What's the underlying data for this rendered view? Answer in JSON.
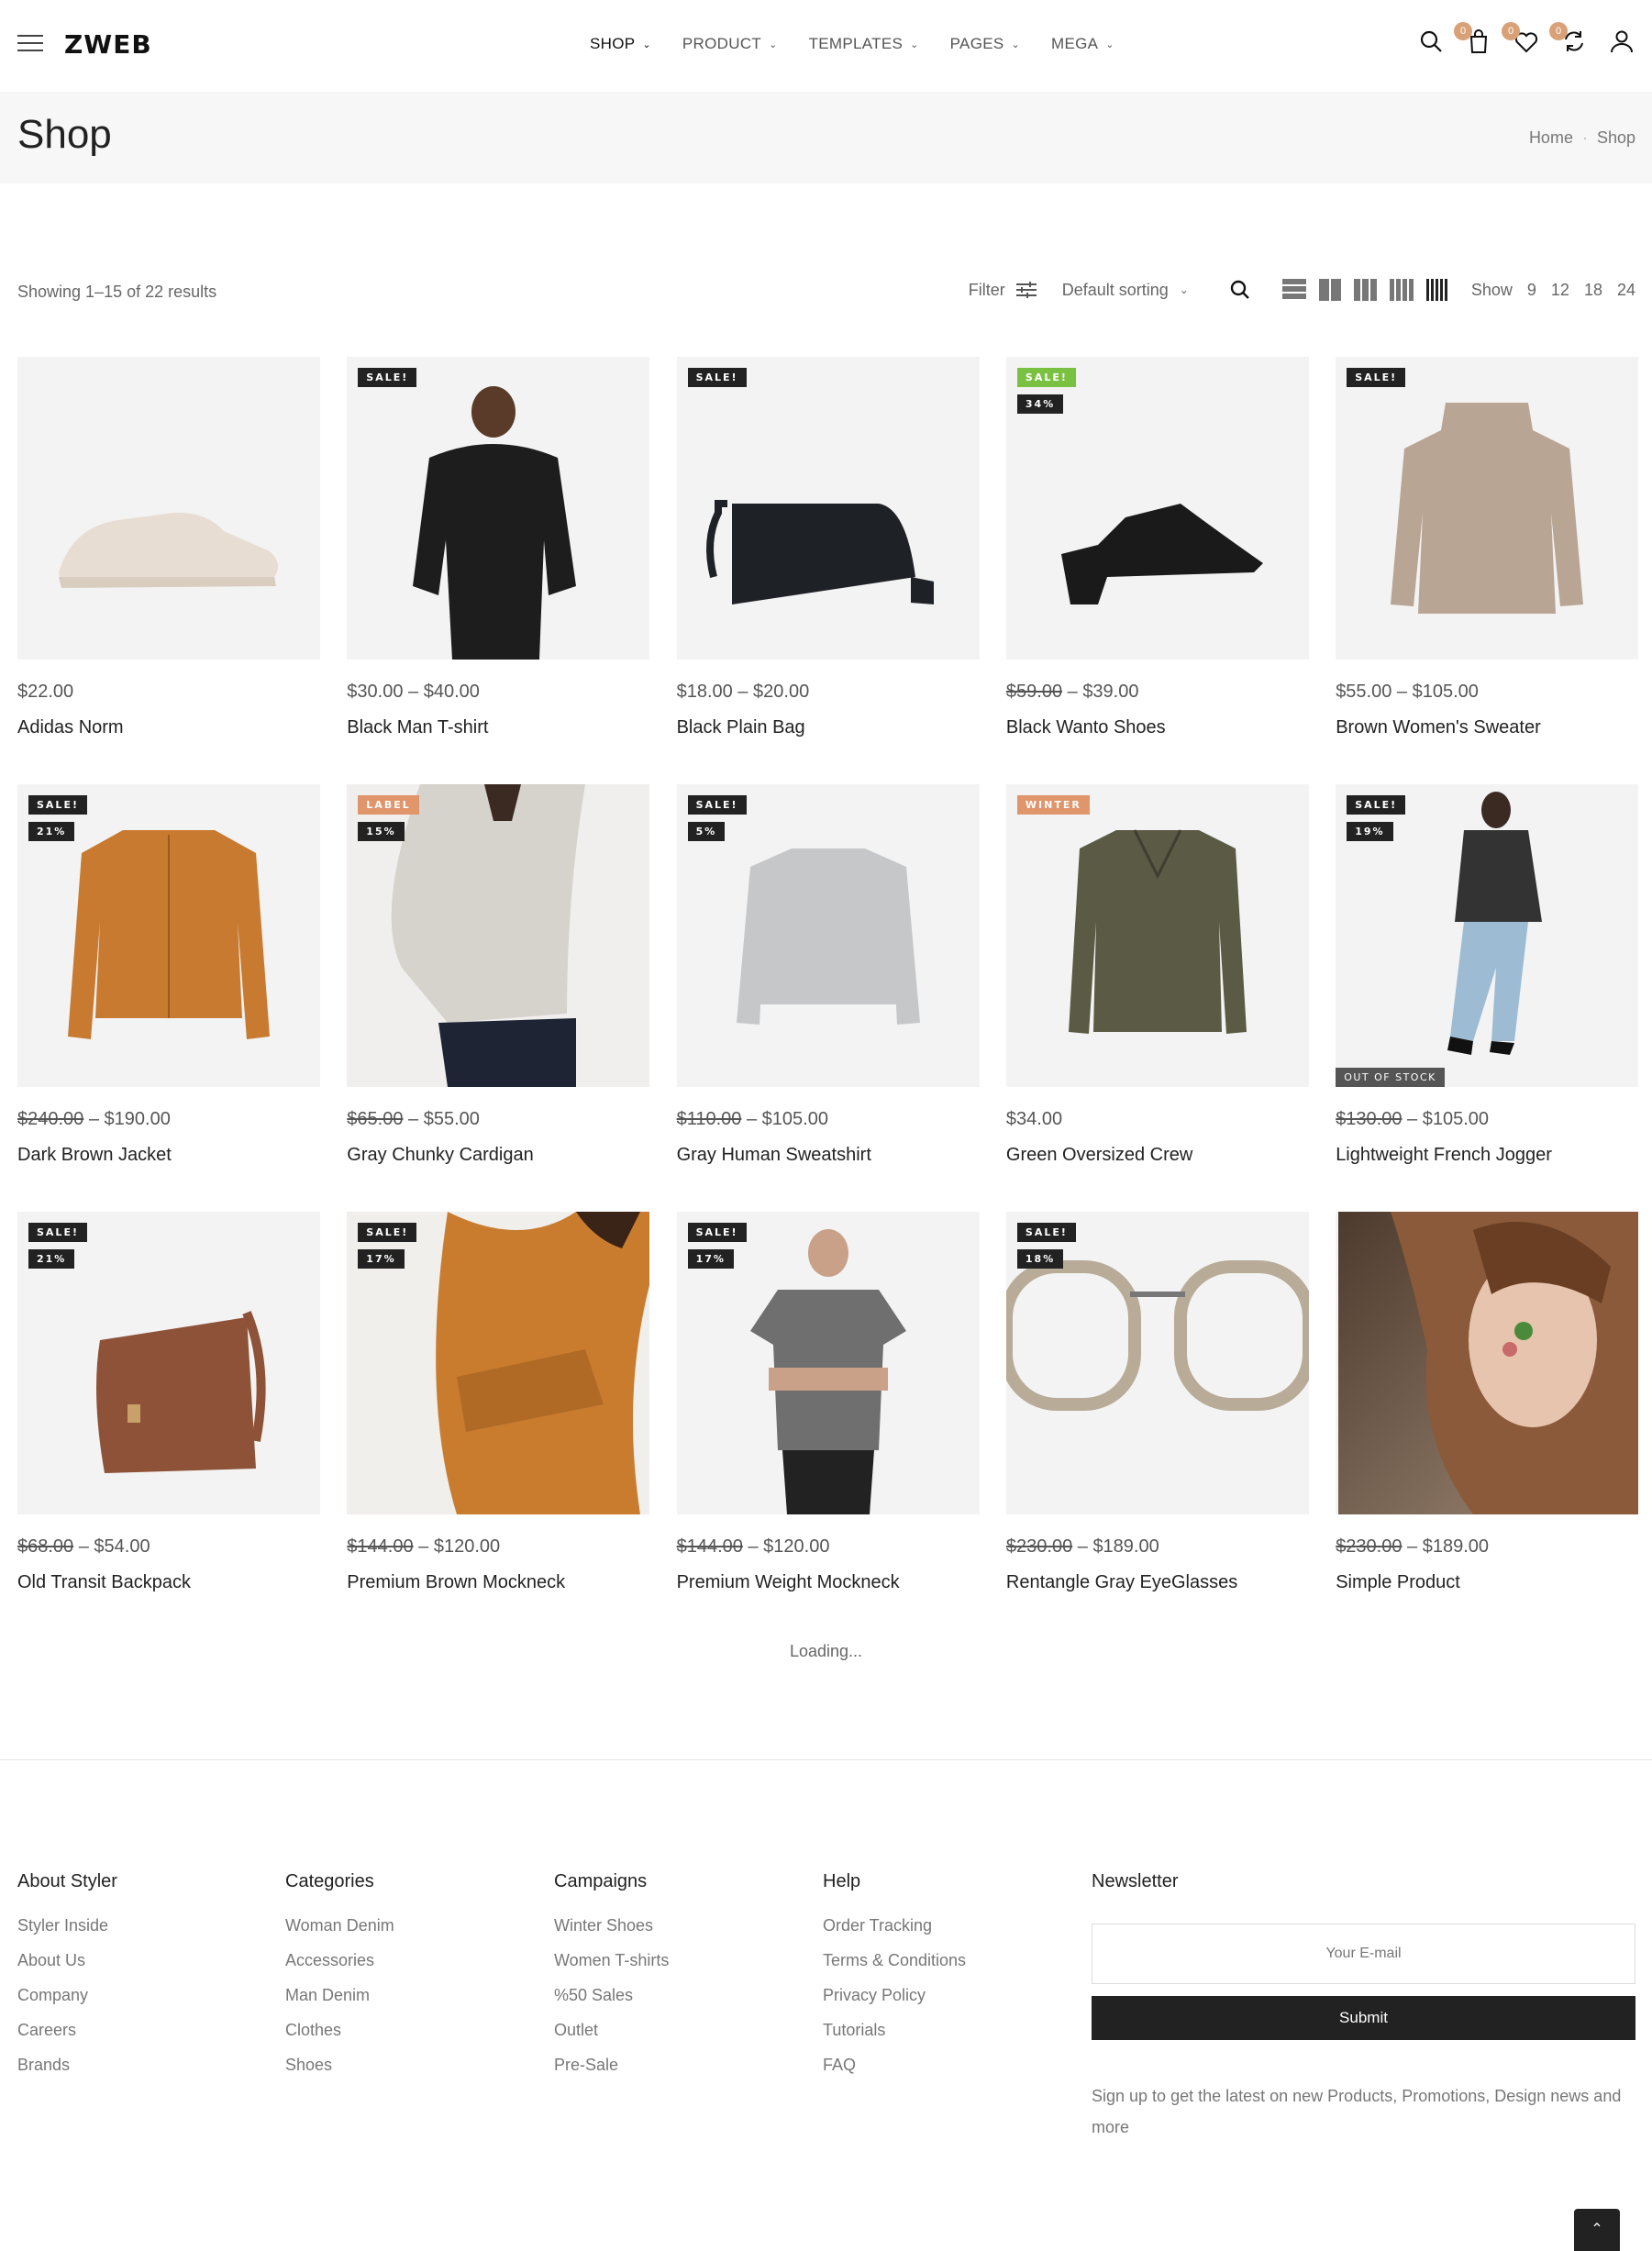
{
  "header": {
    "logo": "ZWEB",
    "nav": [
      {
        "label": "SHOP",
        "active": true
      },
      {
        "label": "PRODUCT",
        "active": false
      },
      {
        "label": "TEMPLATES",
        "active": false
      },
      {
        "label": "PAGES",
        "active": false
      },
      {
        "label": "MEGA",
        "active": false
      }
    ],
    "icons": [
      {
        "name": "search-icon",
        "badge": null
      },
      {
        "name": "cart-icon",
        "badge": "0"
      },
      {
        "name": "wishlist-icon",
        "badge": "0"
      },
      {
        "name": "compare-icon",
        "badge": "0"
      },
      {
        "name": "account-icon",
        "badge": null
      }
    ]
  },
  "titlebar": {
    "title": "Shop",
    "breadcrumb": [
      "Home",
      "Shop"
    ]
  },
  "toolbar": {
    "results": "Showing 1–15 of 22 results",
    "filter": "Filter",
    "sorting": "Default sorting",
    "show_label": "Show",
    "show_options": [
      "9",
      "12",
      "18",
      "24"
    ]
  },
  "products": [
    {
      "name": "Adidas Norm",
      "price": "$22.00",
      "old": null,
      "tags": [],
      "image": "sneaker-image",
      "img_color": "#e8ddd2"
    },
    {
      "name": "Black Man T-shirt",
      "price": "$40.00",
      "low": "$30.00",
      "old": null,
      "tags": [
        "SALE!"
      ],
      "image": "man-sweatshirt-image",
      "img_color": "#1d1d1d"
    },
    {
      "name": "Black Plain Bag",
      "price": "$20.00",
      "low": "$18.00",
      "old": null,
      "tags": [
        "SALE!"
      ],
      "image": "bag-image",
      "img_color": "#1e2126"
    },
    {
      "name": "Black Wanto Shoes",
      "price": "$39.00",
      "old": "$59.00",
      "tags": [
        "SALE!",
        "34%"
      ],
      "tag_green": true,
      "image": "mule-shoe-image",
      "img_color": "#1a1a1a"
    },
    {
      "name": "Brown Women's Sweater",
      "price": "$105.00",
      "low": "$55.00",
      "old": null,
      "tags": [
        "SALE!"
      ],
      "image": "sweater-image",
      "img_color": "#b9a594"
    },
    {
      "name": "Dark Brown Jacket",
      "price": "$190.00",
      "old": "$240.00",
      "tags": [
        "SALE!",
        "21%"
      ],
      "image": "cardigan-image",
      "img_color": "#c77a30"
    },
    {
      "name": "Gray Chunky Cardigan",
      "price": "$55.00",
      "old": "$65.00",
      "tags": [
        "LABEL",
        "15%"
      ],
      "tag_orange": true,
      "image": "woman-cardigan-image",
      "img_color": "#d6d2cc"
    },
    {
      "name": "Gray Human Sweatshirt",
      "price": "$105.00",
      "old": "$110.00",
      "tags": [
        "SALE!",
        "5%"
      ],
      "image": "gray-sweatshirt-image",
      "img_color": "#c6c7c8"
    },
    {
      "name": "Green Oversized Crew",
      "price": "$34.00",
      "old": null,
      "tags": [
        "WINTER"
      ],
      "tag_orange": true,
      "image": "green-polo-image",
      "img_color": "#5b5a45"
    },
    {
      "name": "Lightweight French Jogger",
      "price": "$105.00",
      "old": "$130.00",
      "tags": [
        "SALE!",
        "19%"
      ],
      "oos": "OUT OF STOCK",
      "image": "woman-jeans-image",
      "img_color": "#9dbcd4"
    },
    {
      "name": "Old Transit Backpack",
      "price": "$54.00",
      "old": "$68.00",
      "tags": [
        "SALE!",
        "21%"
      ],
      "image": "leather-bag-image",
      "img_color": "#8d5237"
    },
    {
      "name": "Premium Brown Mockneck",
      "price": "$120.00",
      "old": "$144.00",
      "tags": [
        "SALE!",
        "17%"
      ],
      "image": "woman-orange-cardigan-image",
      "img_color": "#c97c2e"
    },
    {
      "name": "Premium Weight Mockneck",
      "price": "$120.00",
      "old": "$144.00",
      "tags": [
        "SALE!",
        "17%"
      ],
      "image": "man-tshirt-image",
      "img_color": "#6f6f6f"
    },
    {
      "name": "Rentangle Gray EyeGlasses",
      "price": "$189.00",
      "old": "$230.00",
      "tags": [
        "SALE!",
        "18%"
      ],
      "image": "eyeglasses-image",
      "img_color": "#b8ab98"
    },
    {
      "name": "Simple Product",
      "price": "$189.00",
      "old": "$230.00",
      "tags": [],
      "image": "woman-portrait-image",
      "img_color": "#6e5544"
    }
  ],
  "loading": "Loading...",
  "footer": {
    "columns": [
      {
        "title": "About Styler",
        "links": [
          "Styler Inside",
          "About Us",
          "Company",
          "Careers",
          "Brands"
        ]
      },
      {
        "title": "Categories",
        "links": [
          "Woman Denim",
          "Accessories",
          "Man Denim",
          "Clothes",
          "Shoes"
        ]
      },
      {
        "title": "Campaigns",
        "links": [
          "Winter Shoes",
          "Women T-shirts",
          "%50 Sales",
          "Outlet",
          "Pre-Sale"
        ]
      },
      {
        "title": "Help",
        "links": [
          "Order Tracking",
          "Terms & Conditions",
          "Privacy Policy",
          "Tutorials",
          "FAQ"
        ]
      }
    ],
    "newsletter": {
      "title": "Newsletter",
      "placeholder": "Your E-mail",
      "submit": "Submit",
      "text": "Sign up to get the latest on new Products, Promotions, Design news and more"
    }
  }
}
